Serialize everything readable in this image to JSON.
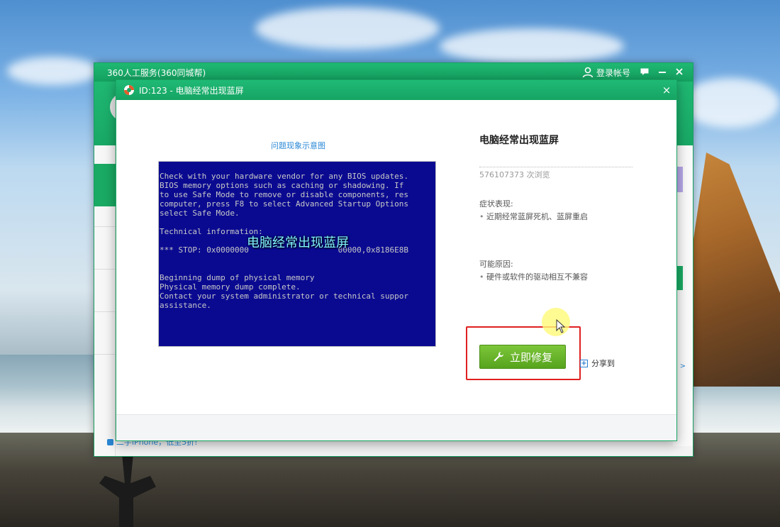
{
  "app_window": {
    "title": "360人工服务(360同城帮)",
    "login_label": "登录帐号",
    "bottom_link": "二手iPhone，低至5折!",
    "more_link": "> >"
  },
  "dialog": {
    "title": "ID:123 - 电脑经常出现蓝屏",
    "close_label": "×",
    "preview_caption": "问题现象示意图",
    "bsod_lines": [
      "Check with your hardware vendor for any BIOS updates.",
      "BIOS memory options such as caching or shadowing. If",
      "to use Safe Mode to remove or disable components, res",
      "computer, press F8 to select Advanced Startup Options",
      "select Safe Mode.",
      "",
      "Technical information:",
      "",
      "*** STOP: 0x0000000                   00000,0x8186E8B",
      "",
      "",
      "Beginning dump of physical memory",
      "Physical memory dump complete.",
      "Contact your system administrator or technical suppor",
      "assistance."
    ],
    "bsod_overlay": "电脑经常出现蓝屏",
    "problem_title": "电脑经常出现蓝屏",
    "views": "576107373 次浏览",
    "symptoms_label": "症状表现:",
    "symptoms": [
      "近期经常蓝屏死机、蓝屏重启"
    ],
    "causes_label": "可能原因:",
    "causes": [
      "硬件或软件的驱动相互不兼容"
    ],
    "fix_button_label": "立即修复",
    "share_label": "分享到"
  },
  "colors": {
    "brand_green": "#1aaa63",
    "fix_button": "#67b52a",
    "highlight": "#e02020",
    "bsod_blue": "#0a0a91",
    "link_blue": "#2a88d6"
  },
  "icons": {
    "user": "user-icon",
    "feedback": "feedback-icon",
    "minimize": "minimize-icon",
    "close": "close-icon",
    "lifebuoy": "lifebuoy-icon",
    "wrench": "wrench-icon",
    "share": "plus-icon"
  }
}
